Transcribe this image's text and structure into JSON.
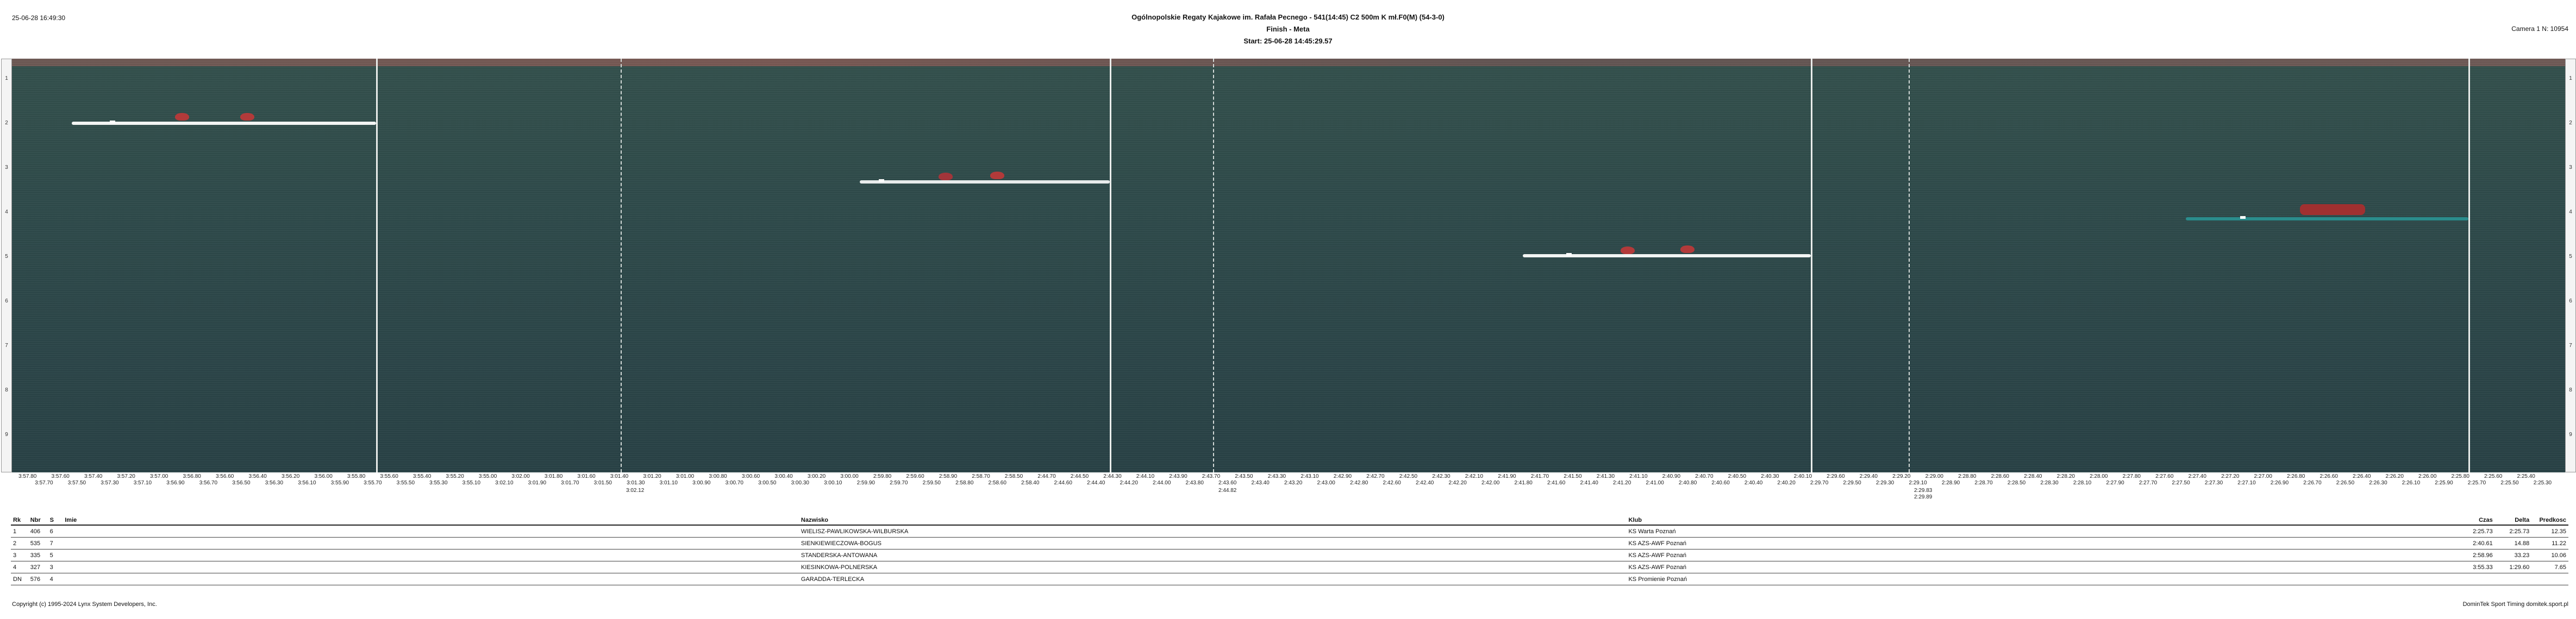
{
  "header": {
    "datetime": "25-06-28 16:49:30",
    "title": "Ogólnopolskie Regaty Kajakowe im. Rafała Pecnego - 541(14:45) C2 500m K mł.F0(M) (54-3-0)",
    "subtitle": "Finish - Meta",
    "start": "Start: 25-06-28 14:45:29.57",
    "camera": "Camera 1 N: 10954"
  },
  "scale": {
    "ticks": [
      "1",
      "2",
      "3",
      "4",
      "5",
      "6",
      "7",
      "8",
      "9"
    ]
  },
  "time_axis": {
    "upper": [
      "3:57.80",
      "3:57.70",
      "3:57.60",
      "3:57.50",
      "3:57.40",
      "3:57.30",
      "3:57.20",
      "3:57.10",
      "3:57.00",
      "3:56.90",
      "3:56.80",
      "3:56.70",
      "3:56.60",
      "3:56.50",
      "3:56.40",
      "3:56.30",
      "3:56.20",
      "3:56.10",
      "3:56.00",
      "3:55.90",
      "3:55.80",
      "3:55.70",
      "3:55.60",
      "3:55.50",
      "3:55.40",
      "3:55.30",
      "3:55.20",
      "3:55.10",
      "3:55.00",
      "3:02.10",
      "3:02.00",
      "3:01.90",
      "3:01.80",
      "3:01.70",
      "3:01.60",
      "3:01.50",
      "3:01.40",
      "3:01.30",
      "3:01.20",
      "3:01.10",
      "3:01.00",
      "3:00.90",
      "3:00.80",
      "3:00.70",
      "3:00.60",
      "3:00.50",
      "3:00.40",
      "3:00.30",
      "3:00.20",
      "3:00.10",
      "3:00.00",
      "2:59.90",
      "2:59.80",
      "2:59.70",
      "2:59.60",
      "2:59.50",
      "2:58.90",
      "2:58.80",
      "2:58.70",
      "2:58.60",
      "2:58.50",
      "2:58.40",
      "2:44.70",
      "2:44.60",
      "2:44.50",
      "2:44.40",
      "2:44.30",
      "2:44.20",
      "2:44.10",
      "2:44.00",
      "2:43.90",
      "2:43.80",
      "2:43.70",
      "2:43.60",
      "2:43.50",
      "2:43.40",
      "2:43.30",
      "2:43.20",
      "2:43.10",
      "2:43.00",
      "2:42.90",
      "2:42.80",
      "2:42.70",
      "2:42.60",
      "2:42.50",
      "2:42.40",
      "2:42.30",
      "2:42.20",
      "2:42.10",
      "2:42.00",
      "2:41.90",
      "2:41.80",
      "2:41.70",
      "2:41.60",
      "2:41.50",
      "2:41.40",
      "2:41.30",
      "2:41.20",
      "2:41.10",
      "2:41.00",
      "2:40.90",
      "2:40.80",
      "2:40.70",
      "2:40.60",
      "2:40.50",
      "2:40.40",
      "2:40.30",
      "2:40.20",
      "2:40.10",
      "2:29.70",
      "2:29.60",
      "2:29.50",
      "2:29.40",
      "2:29.30",
      "2:29.20",
      "2:29.10",
      "2:29.00",
      "2:28.90",
      "2:28.80",
      "2:28.70",
      "2:28.60",
      "2:28.50",
      "2:28.40",
      "2:28.30",
      "2:28.20",
      "2:28.10",
      "2:28.00",
      "2:27.90",
      "2:27.80",
      "2:27.70",
      "2:27.60",
      "2:27.50",
      "2:27.40",
      "2:27.30",
      "2:27.20",
      "2:27.10",
      "2:27.00",
      "2:26.90",
      "2:26.80",
      "2:26.70",
      "2:26.60",
      "2:26.50",
      "2:26.40",
      "2:26.30",
      "2:26.20",
      "2:26.10",
      "2:26.00",
      "2:25.90",
      "2:25.80",
      "2:25.70",
      "2:25.60",
      "2:25.50",
      "2:25.40",
      "2:25.30"
    ],
    "split_labels": [
      "3:02.12",
      "2:44.82",
      "2:29.83",
      "2:29.89"
    ]
  },
  "results": {
    "columns": [
      "Rk",
      "Nbr",
      "S",
      "Imie",
      "Nazwisko",
      "Klub",
      "Czas",
      "Delta",
      "Predkosc"
    ],
    "rows": [
      {
        "rk": "1",
        "nbr": "406",
        "s": "6",
        "imie": "",
        "nazwisko": "WIELISZ-PAWLIKOWSKA-WILBURSKA",
        "klub": "KS Warta Poznań",
        "czas": "2:25.73",
        "delta": "2:25.73",
        "speed": "12.35"
      },
      {
        "rk": "2",
        "nbr": "535",
        "s": "7",
        "imie": "",
        "nazwisko": "SIENKIEWIECZOWA-BOGUS",
        "klub": "KS AZS-AWF Poznań",
        "czas": "2:40.61",
        "delta": "14.88",
        "speed": "11.22"
      },
      {
        "rk": "3",
        "nbr": "335",
        "s": "5",
        "imie": "",
        "nazwisko": "STANDERSKA-ANTOWANA",
        "klub": "KS AZS-AWF Poznań",
        "czas": "2:58.96",
        "delta": "33.23",
        "speed": "10.06"
      },
      {
        "rk": "4",
        "nbr": "327",
        "s": "3",
        "imie": "",
        "nazwisko": "KIESINKOWA-POLNERSKA",
        "klub": "KS AZS-AWF Poznań",
        "czas": "3:55.33",
        "delta": "1:29.60",
        "speed": "7.65"
      },
      {
        "rk": "DN",
        "nbr": "576",
        "s": "4",
        "imie": "",
        "nazwisko": "GARADDA-TERLECKA",
        "klub": "KS Promienie Poznań",
        "czas": "",
        "delta": "",
        "speed": ""
      }
    ]
  },
  "footer": {
    "left": "Copyright (c) 1995-2024 Lynx System Developers, Inc.",
    "right": "DominTek Sport Timing domitek.sport.pl"
  },
  "colors": {
    "water": "#2e4a4a",
    "paddler": "#b23a3a",
    "boat_white": "#f2f4f3",
    "boat_teal": "#2a8c8c"
  }
}
